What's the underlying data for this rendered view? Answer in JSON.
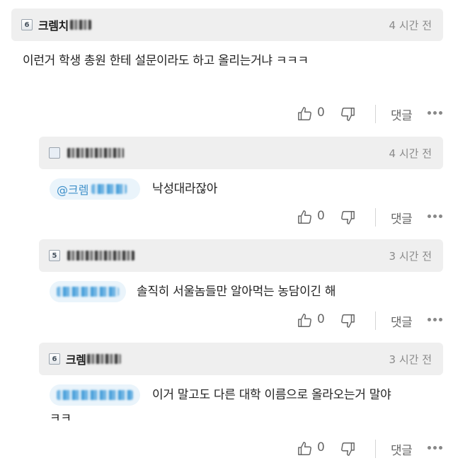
{
  "comments": [
    {
      "badge": "6",
      "username": "크렘치",
      "time": "4 시간 전",
      "body": "이런거 학생 총원 한테 설문이라도 하고 올리는거냐 ㅋㅋㅋ",
      "likes": "0",
      "reply_label": "댓글"
    },
    {
      "badge": "",
      "username": "",
      "time": "4 시간 전",
      "mention": "@크렘",
      "body": "낙성대라잖아",
      "likes": "0",
      "reply_label": "댓글"
    },
    {
      "badge": "5",
      "username": "",
      "time": "3 시간 전",
      "mention": "",
      "body": "솔직히 서울놈들만 알아먹는 농담이긴 해",
      "likes": "0",
      "reply_label": "댓글"
    },
    {
      "badge": "6",
      "username": "크렘",
      "time": "3 시간 전",
      "mention": "",
      "body_line1": "이거 말고도 다른 대학 이름으로 올라오는거 말야",
      "body_line2": "ㅋㅋ",
      "likes": "0",
      "reply_label": "댓글"
    }
  ]
}
